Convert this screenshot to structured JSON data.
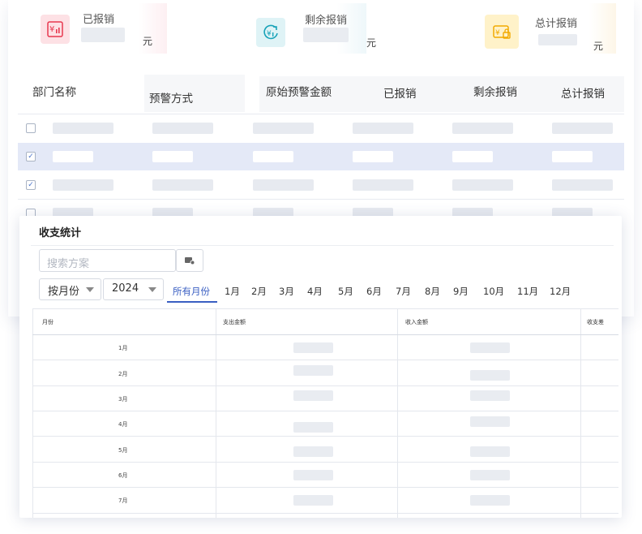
{
  "summary": {
    "reimbursed": {
      "title": "已报销",
      "unit": "元",
      "icon": "yuan-chart-icon",
      "color": "#e8384f"
    },
    "remaining": {
      "title": "剩余报销",
      "unit": "元",
      "icon": "yuan-refresh-icon",
      "color": "#17a2b8"
    },
    "total": {
      "title": "总计报销",
      "unit": "元",
      "icon": "yuan-lock-icon",
      "color": "#f2a900"
    }
  },
  "table": {
    "columns": [
      "部门名称",
      "预警方式",
      "原始预警金额",
      "已报销",
      "剩余报销",
      "总计报销"
    ],
    "rows": [
      {
        "checked": false,
        "highlighted": false
      },
      {
        "checked": true,
        "highlighted": true
      },
      {
        "checked": true,
        "highlighted": false
      }
    ]
  },
  "panel": {
    "title": "收支统计",
    "search_placeholder": "搜索方案",
    "period_select": "按月份",
    "year_select": "2024",
    "month_tabs": [
      "所有月份",
      "1月",
      "2月",
      "3月",
      "4月",
      "5月",
      "6月",
      "7月",
      "8月",
      "9月",
      "10月",
      "11月",
      "12月"
    ],
    "active_tab": "所有月份",
    "stats_table": {
      "columns": [
        "月份",
        "支出金额",
        "收入金额",
        "收支差"
      ],
      "months": [
        "1月",
        "2月",
        "3月",
        "4月",
        "5月",
        "6月",
        "7月"
      ]
    }
  }
}
